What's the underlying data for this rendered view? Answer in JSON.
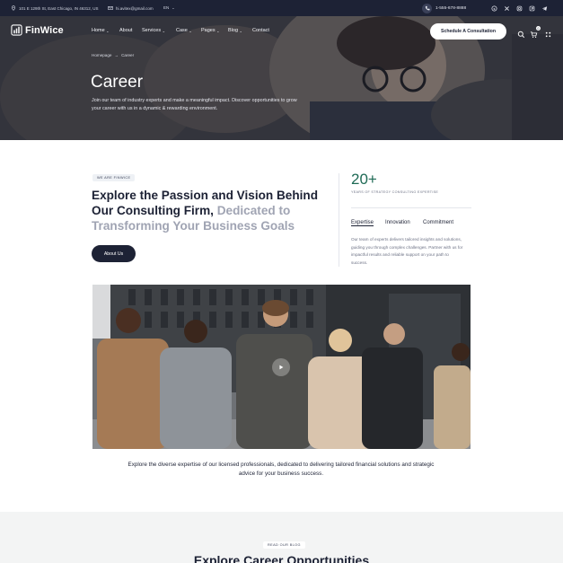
{
  "topbar": {
    "address": "101 E 129th St, East Chicago, IN 46312, US",
    "email": "hi.avitex@gmail.com",
    "language": "EN",
    "phone": "1-555-678-8888",
    "social_icons": [
      "skype-icon",
      "x-icon",
      "instagram-icon",
      "pinterest-icon",
      "telegram-icon"
    ]
  },
  "nav": {
    "logo_text": "FinWice",
    "links": [
      {
        "label": "Home",
        "has_dropdown": true
      },
      {
        "label": "About",
        "has_dropdown": false
      },
      {
        "label": "Services",
        "has_dropdown": true
      },
      {
        "label": "Case",
        "has_dropdown": true
      },
      {
        "label": "Pages",
        "has_dropdown": true
      },
      {
        "label": "Blog",
        "has_dropdown": true
      },
      {
        "label": "Contact",
        "has_dropdown": false
      }
    ],
    "cta_label": "Schedule A Consultation",
    "cart_count": "0"
  },
  "hero": {
    "breadcrumb_home": "Homepage",
    "breadcrumb_separator": "→",
    "breadcrumb_current": "Career",
    "title": "Career",
    "description": "Join our team of industry experts and make a meaningful impact. Discover opportunities to grow your career with us in a dynamic & rewarding environment."
  },
  "intro": {
    "tag": "WE ARE FINWICE",
    "heading_main": "Explore the Passion and Vision Behind Our Consulting Firm,",
    "heading_muted": " Dedicated to Transforming Your Business Goals",
    "button_label": "About Us",
    "stat_value": "20+",
    "stat_label": "YEARS OF STRATEGY CONSULTING EXPERTISE",
    "tabs": [
      "Expertise",
      "Innovation",
      "Commitment"
    ],
    "active_tab": "Expertise",
    "tab_description": "Our team of experts delivers tailored insights and solutions, guiding you through complex challenges. Partner with us for impactful results and reliable support on your path to success."
  },
  "video": {
    "caption": "Explore the diverse expertise of our licensed professionals, dedicated to delivering tailored financial solutions and strategic advice for your business success."
  },
  "blog": {
    "tag": "READ OUR BLOG",
    "heading": "Explore Career Opportunities"
  },
  "colors": {
    "navy": "#1d2235",
    "accent_green": "#1e6a55",
    "muted_text": "#a0a4b3",
    "light_bg": "#f3f4f4"
  }
}
